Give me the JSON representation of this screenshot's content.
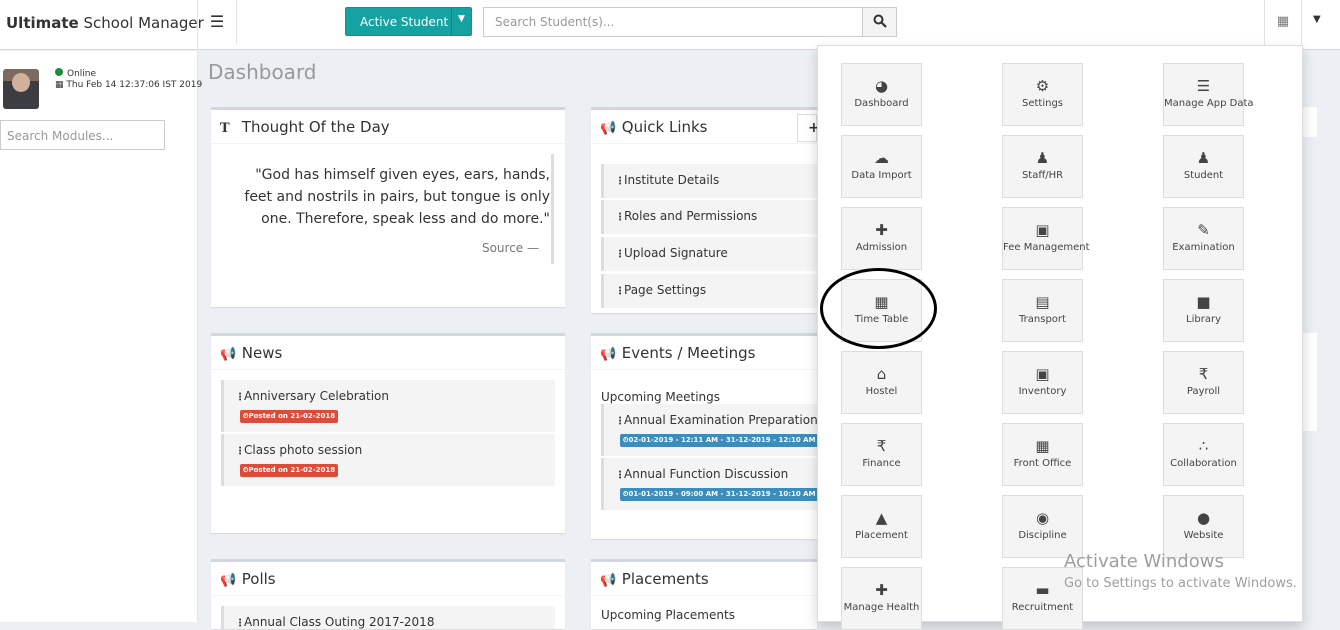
{
  "app": {
    "title_bold": "Ultimate",
    "title_rest": "School Manager"
  },
  "topbar": {
    "active_student_label": "Active Student",
    "search_placeholder": "Search Student(s)..."
  },
  "sidebar": {
    "status": "Online",
    "datetime": "Thu Feb 14 12:37:06 IST 2019",
    "module_search_placeholder": "Search Modules..."
  },
  "page": {
    "title": "Dashboard"
  },
  "thought": {
    "title": "Thought Of the Day",
    "quote": "\"God has himself given eyes, ears, hands, feet and nostrils in pairs, but tongue is only one. Therefore, speak less and do more.\"",
    "source": "Source —"
  },
  "quick_links": {
    "title": "Quick Links",
    "items": [
      "Institute Details",
      "Roles and Permissions",
      "Upload Signature",
      "Page Settings"
    ]
  },
  "news": {
    "title": "News",
    "items": [
      {
        "title": "Anniversary Celebration",
        "badge": "⏲Posted on 21-02-2018"
      },
      {
        "title": "Class photo session",
        "badge": "⏲Posted on 21-02-2018"
      }
    ]
  },
  "events": {
    "title": "Events / Meetings",
    "subtitle": "Upcoming Meetings",
    "items": [
      {
        "title": "Annual Examination Preparation",
        "badge": "⏲02-01-2019 - 12:11 AM - 31-12-2019 - 12:10 AM"
      },
      {
        "title": "Annual Function Discussion",
        "badge": "⏲01-01-2019 - 09:00 AM - 31-12-2019 - 10:10 AM"
      }
    ]
  },
  "polls": {
    "title": "Polls",
    "partial_item": "Annual Class Outing 2017-2018"
  },
  "placements": {
    "title": "Placements",
    "subtitle": "Upcoming Placements"
  },
  "modules": [
    {
      "label": "Dashboard",
      "icon": "dashboard-icon",
      "glyph": "◕"
    },
    {
      "label": "Settings",
      "icon": "cogs-icon",
      "glyph": "⚙"
    },
    {
      "label": "Manage App Data",
      "icon": "database-icon",
      "glyph": "☰"
    },
    {
      "label": "Data Import",
      "icon": "cloud-upload-icon",
      "glyph": "☁"
    },
    {
      "label": "Staff/HR",
      "icon": "users-icon",
      "glyph": "♟"
    },
    {
      "label": "Student",
      "icon": "user-icon",
      "glyph": "♟"
    },
    {
      "label": "Admission",
      "icon": "user-plus-icon",
      "glyph": "✚"
    },
    {
      "label": "Fee Management",
      "icon": "money-icon",
      "glyph": "▣"
    },
    {
      "label": "Examination",
      "icon": "edit-icon",
      "glyph": "✎"
    },
    {
      "label": "Time Table",
      "icon": "calendar-icon",
      "glyph": "▦"
    },
    {
      "label": "Transport",
      "icon": "bus-icon",
      "glyph": "▤"
    },
    {
      "label": "Library",
      "icon": "book-icon",
      "glyph": "■"
    },
    {
      "label": "Hostel",
      "icon": "home-icon",
      "glyph": "⌂"
    },
    {
      "label": "Inventory",
      "icon": "money-icon",
      "glyph": "▣"
    },
    {
      "label": "Payroll",
      "icon": "rupee-icon",
      "glyph": "₹"
    },
    {
      "label": "Finance",
      "icon": "rupee-icon",
      "glyph": "₹"
    },
    {
      "label": "Front Office",
      "icon": "calendar-icon",
      "glyph": "▦"
    },
    {
      "label": "Collaboration",
      "icon": "share-icon",
      "glyph": "∴"
    },
    {
      "label": "Placement",
      "icon": "graduation-cap-icon",
      "glyph": "▲"
    },
    {
      "label": "Discipline",
      "icon": "eye-icon",
      "glyph": "◉"
    },
    {
      "label": "Website",
      "icon": "globe-icon",
      "glyph": "●"
    },
    {
      "label": "Manage Health",
      "icon": "medkit-icon",
      "glyph": "✚"
    },
    {
      "label": "Recruitment",
      "icon": "briefcase-icon",
      "glyph": "▬"
    }
  ],
  "watermark": {
    "line1": "Activate Windows",
    "line2": "Go to Settings to activate Windows."
  }
}
